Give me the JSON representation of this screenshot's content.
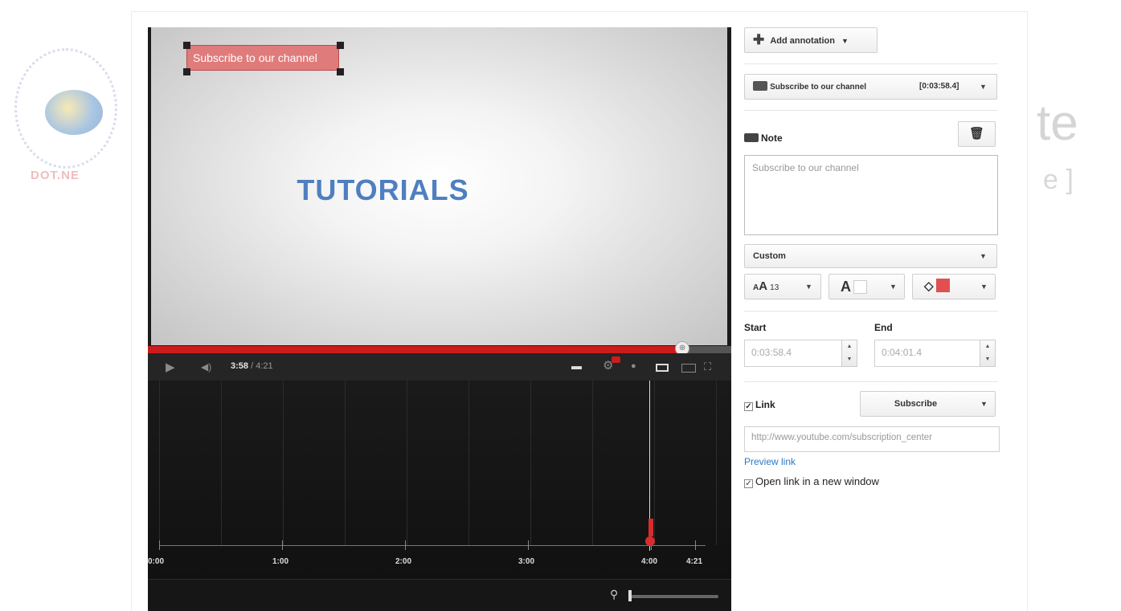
{
  "watermark": {
    "logo_text": "DOT.NE",
    "right_big": "te",
    "right_small": "e ]"
  },
  "video": {
    "title": "TUTORIALS",
    "annotation_text": "Subscribe to our channel",
    "progress_fraction": 0.916,
    "time_current": "3:58",
    "time_total": " / 4:21"
  },
  "timeline": {
    "ticks": [
      "0:00",
      "1:00",
      "2:00",
      "3:00",
      "4:00",
      "4:21"
    ]
  },
  "panel": {
    "add_annotation_label": "Add annotation",
    "annotation_select": {
      "name": "Subscribe to our channel",
      "time": "[0:03:58.4]"
    },
    "note_label": "Note",
    "note_text": "Subscribe to our channel",
    "style_select": "Custom",
    "font_size": "13",
    "font_letter": "A",
    "text_color": "#ffffff",
    "bg_color": "#e05050",
    "start_label": "Start",
    "end_label": "End",
    "start_value": "0:03:58.4",
    "end_value": "0:04:01.4",
    "link_label": "Link",
    "link_checked": "✓",
    "link_type": "Subscribe",
    "link_url": "http://www.youtube.com/subscription_center",
    "preview_link": "Preview link",
    "open_new_window": "Open link in a new window"
  }
}
